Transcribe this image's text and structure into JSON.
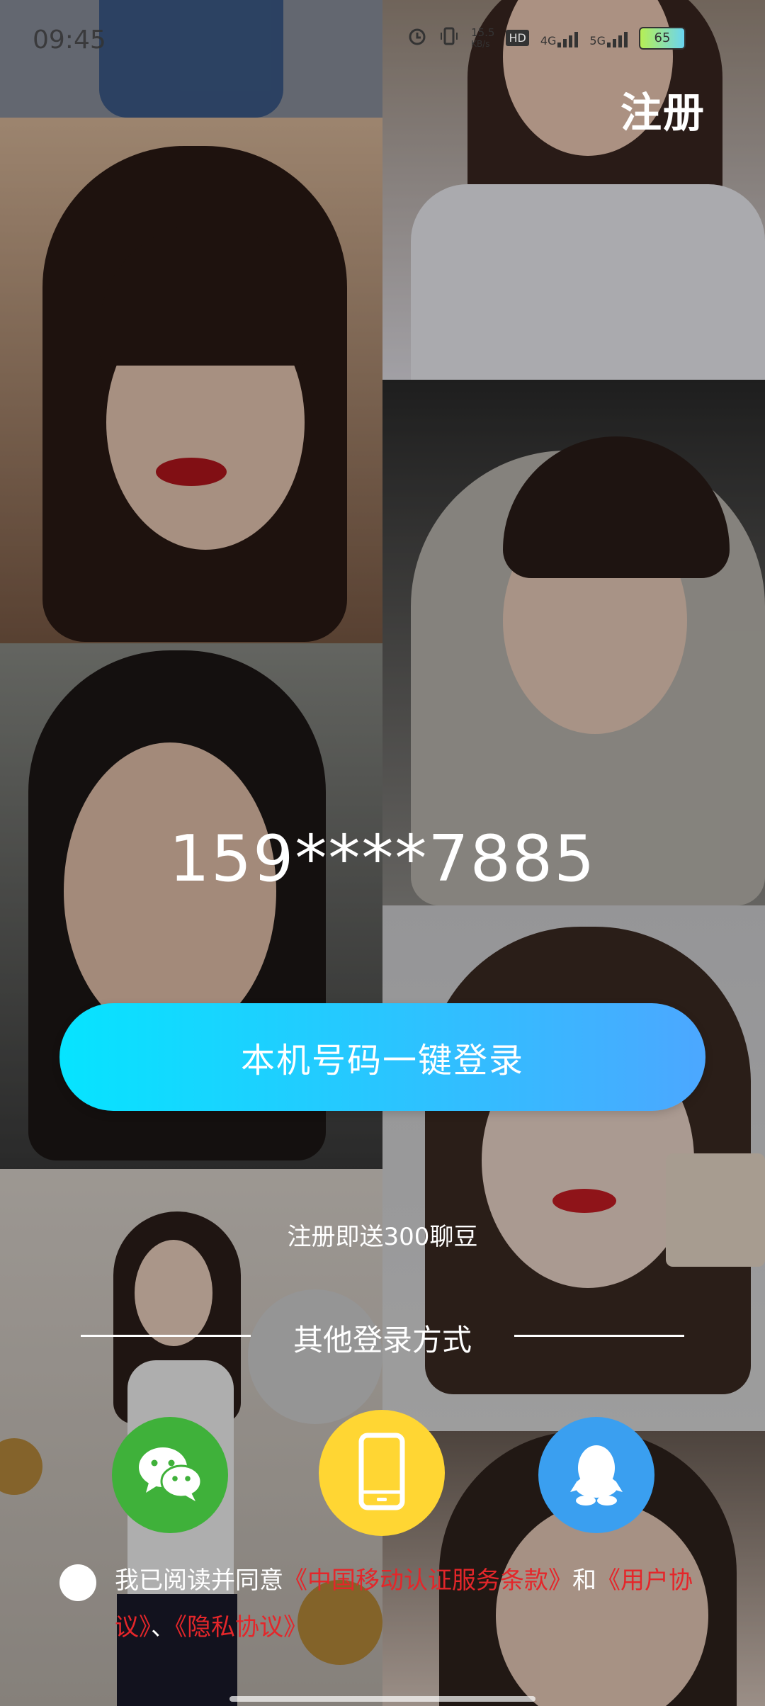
{
  "status_bar": {
    "time": "09:45",
    "net_speed_value": "15.5",
    "net_speed_unit": "KB/s",
    "hd_label": "HD",
    "network_1": "4G",
    "network_2": "5G",
    "battery": "65"
  },
  "header": {
    "register_label": "注册"
  },
  "login": {
    "masked_phone": "159****7885",
    "one_key_button": "本机号码一键登录",
    "bonus_text": "注册即送300聊豆",
    "other_methods_label": "其他登录方式"
  },
  "social": {
    "wechat": "wechat-icon",
    "phone": "phone-icon",
    "qq": "qq-icon"
  },
  "agreement": {
    "prefix": "我已阅读并同意",
    "terms_cmcc": "《中国移动认证服务条款》",
    "and": "和",
    "user_agreement": "《用户协议》",
    "sep": "、",
    "privacy": "《隐私协议》"
  },
  "colors": {
    "button_gradient_start": "#06e4ff",
    "button_gradient_end": "#4ca7ff",
    "wechat": "#3fb13a",
    "phone": "#ffd633",
    "qq": "#3a9ff0",
    "link_red": "#e4262a"
  }
}
